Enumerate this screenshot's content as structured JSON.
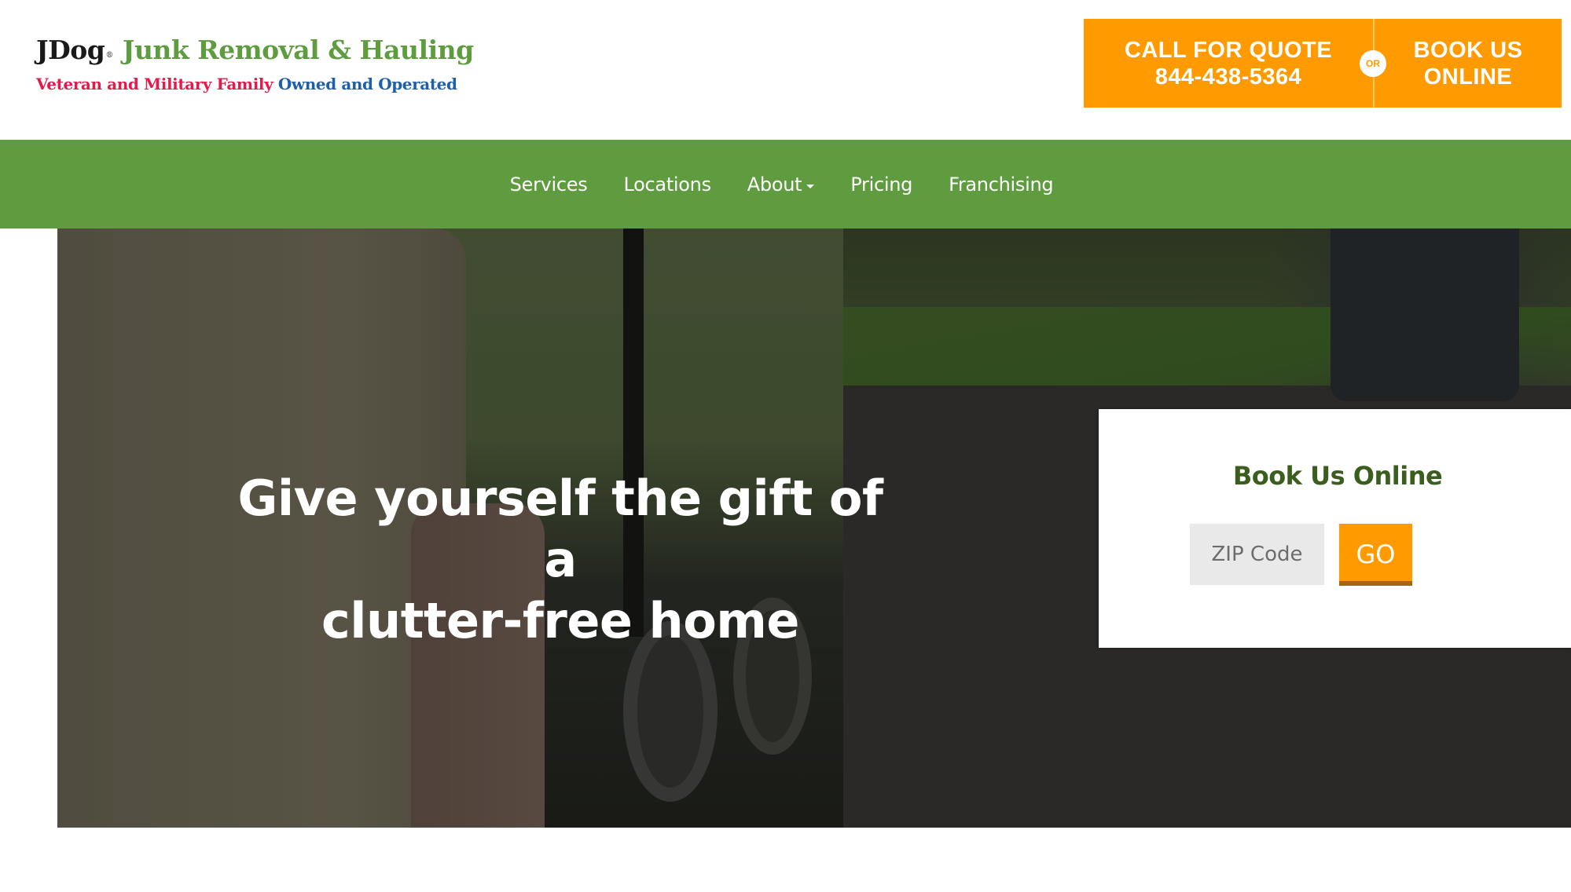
{
  "header": {
    "logo": {
      "brand": "JDog",
      "registered": "®",
      "tagline": "Junk Removal & Hauling",
      "subtitle_red": "Veteran and Military Family",
      "subtitle_blue": "Owned and Operated"
    },
    "cta": {
      "call_label": "CALL FOR QUOTE",
      "phone": "844-438-5364",
      "or_label": "OR",
      "book_line1": "BOOK US",
      "book_line2": "ONLINE"
    }
  },
  "nav": {
    "items": [
      {
        "label": "Services",
        "has_dropdown": false
      },
      {
        "label": "Locations",
        "has_dropdown": false
      },
      {
        "label": "About",
        "has_dropdown": true
      },
      {
        "label": "Pricing",
        "has_dropdown": false
      },
      {
        "label": "Franchising",
        "has_dropdown": false
      }
    ]
  },
  "hero": {
    "headline_line1": "Give yourself the gift of a",
    "headline_line2": "clutter-free home"
  },
  "booking": {
    "title": "Book Us Online",
    "zip_placeholder": "ZIP Code",
    "zip_value": "",
    "go_label": "GO"
  },
  "colors": {
    "brand_green": "#5f9c3f",
    "accent_orange": "#ff9a00",
    "title_green": "#3b5e1f",
    "logo_red": "#e31b4c",
    "logo_blue": "#1f5fa8"
  }
}
